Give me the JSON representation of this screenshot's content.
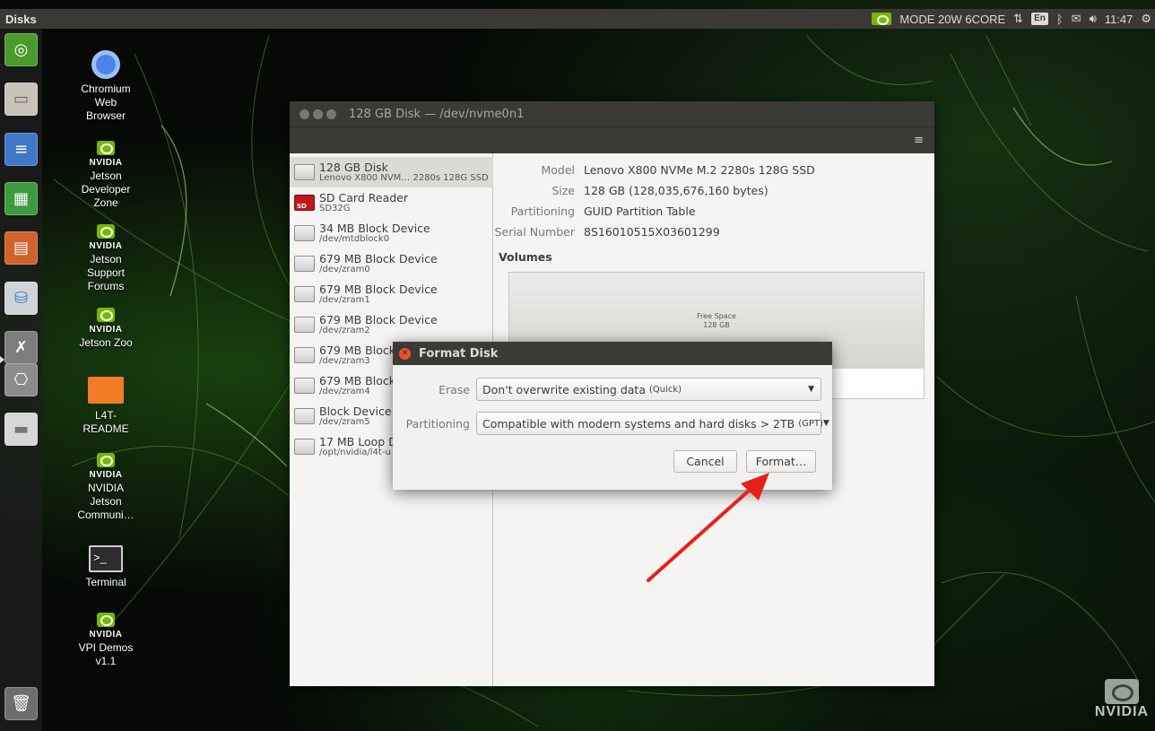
{
  "top_panel": {
    "app_title": "Disks",
    "power_mode": "MODE 20W 6CORE",
    "keyboard_layout": "En",
    "clock": "11:47"
  },
  "desktop_icons": [
    {
      "label": "Chromium\nWeb\nBrowser"
    },
    {
      "label": "Jetson\nDeveloper\nZone",
      "logo": "NVIDIA"
    },
    {
      "label": "Jetson\nSupport\nForums",
      "logo": "NVIDIA"
    },
    {
      "label": "Jetson Zoo",
      "logo": "NVIDIA"
    },
    {
      "label": "L4T-\nREADME"
    },
    {
      "label": "NVIDIA\nJetson\nCommuni…",
      "logo": "NVIDIA"
    },
    {
      "label": "Terminal"
    },
    {
      "label": "VPI Demos\nv1.1",
      "logo": "NVIDIA"
    }
  ],
  "disks_window": {
    "title": "128 GB Disk — /dev/nvme0n1",
    "devices": [
      {
        "name": "128 GB Disk",
        "sub": "Lenovo X800 NVM… 2280s 128G SSD"
      },
      {
        "name": "SD Card Reader",
        "sub": "SD32G"
      },
      {
        "name": "34 MB Block Device",
        "sub": "/dev/mtdblock0"
      },
      {
        "name": "679 MB Block Device",
        "sub": "/dev/zram0"
      },
      {
        "name": "679 MB Block Device",
        "sub": "/dev/zram1"
      },
      {
        "name": "679 MB Block Device",
        "sub": "/dev/zram2"
      },
      {
        "name": "679 MB Block",
        "sub": "/dev/zram3"
      },
      {
        "name": "679 MB Block",
        "sub": "/dev/zram4"
      },
      {
        "name": "Block Device",
        "sub": "/dev/zram5"
      },
      {
        "name": "17 MB Loop D",
        "sub": "/opt/nvidia/l4t-u"
      }
    ],
    "properties": {
      "model_label": "Model",
      "model_value": "Lenovo X800 NVMe M.2 2280s 128G SSD",
      "size_label": "Size",
      "size_value": "128 GB (128,035,676,160 bytes)",
      "partitioning_label": "Partitioning",
      "partitioning_value": "GUID Partition Table",
      "serial_label": "Serial Number",
      "serial_value": "8S16010515X03601299"
    },
    "volumes_heading": "Volumes",
    "free_space_label": "Free Space",
    "free_space_size": "128 GB"
  },
  "format_dialog": {
    "title": "Format Disk",
    "erase_label": "Erase",
    "erase_value": "Don't overwrite existing data",
    "erase_hint": "(Quick)",
    "partitioning_label": "Partitioning",
    "partitioning_value": "Compatible with modern systems and hard disks > 2TB",
    "partitioning_hint": "(GPT)",
    "cancel_label": "Cancel",
    "format_label": "Format…"
  },
  "watermark": "NVIDIA",
  "colors": {
    "nvidia_green": "#76b900",
    "annotation_arrow": "#e8201c"
  }
}
